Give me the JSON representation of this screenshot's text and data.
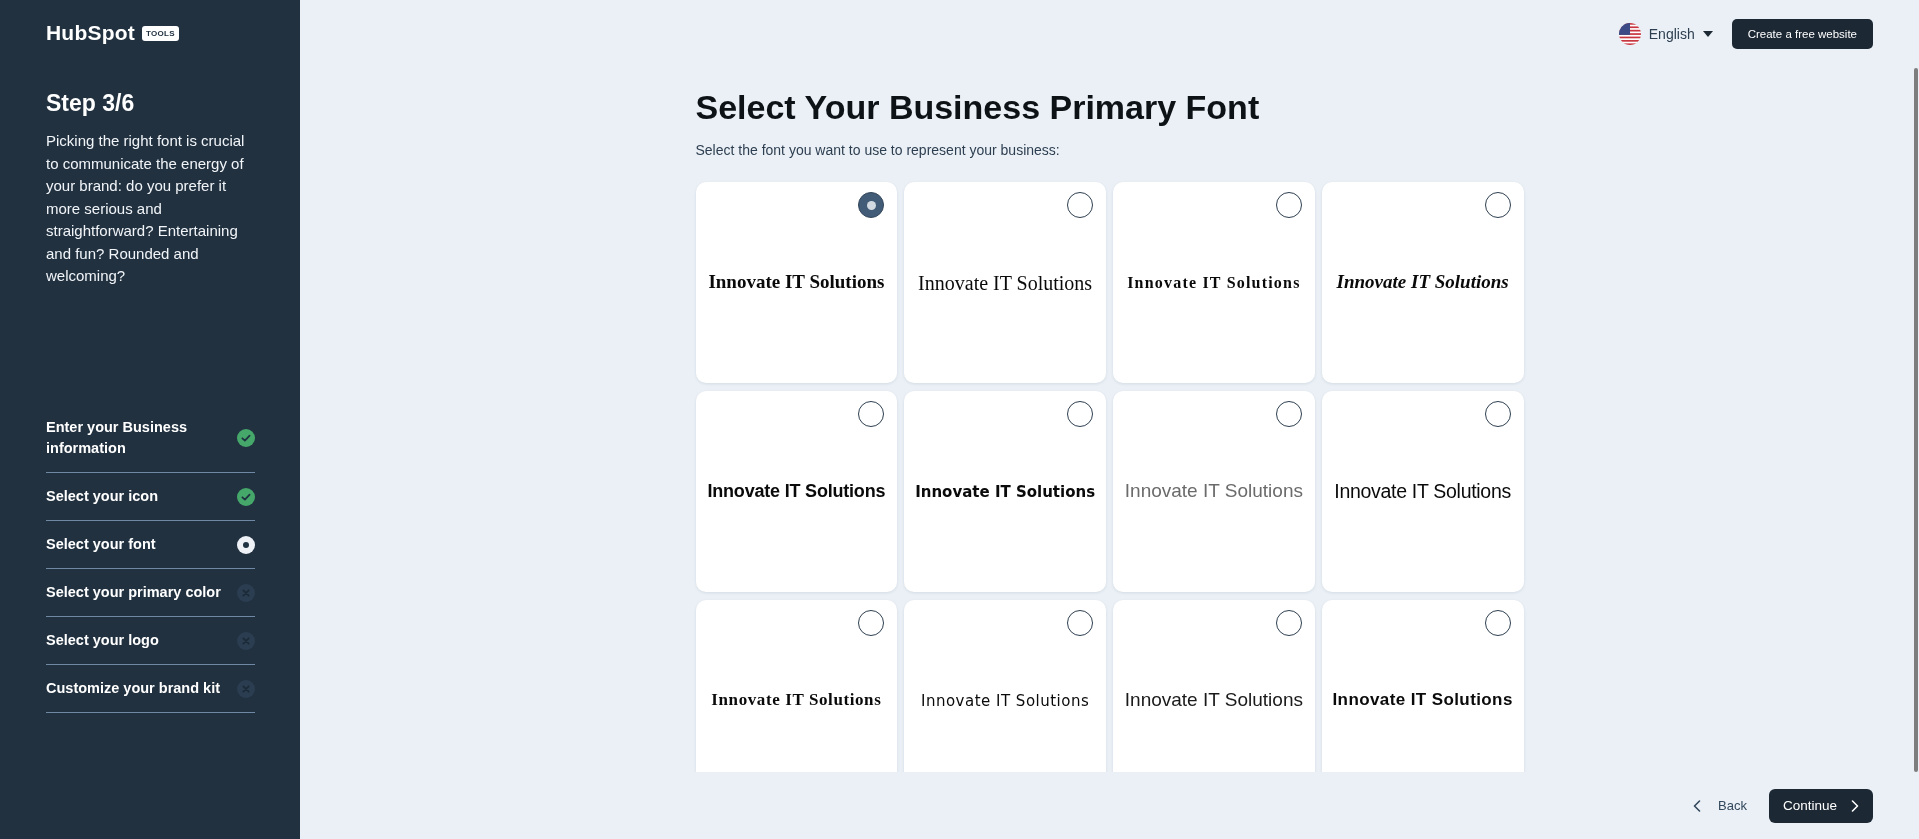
{
  "logo": {
    "name": "HubSpot",
    "badge": "TOOLS"
  },
  "sidebar": {
    "step": "Step 3/6",
    "description": "Picking the right font is crucial to communicate the energy of your brand: do you prefer it more serious and straightforward? Entertaining and fun? Rounded and welcoming?",
    "steps": [
      {
        "label": "Enter your Business information",
        "completed": true,
        "current": false
      },
      {
        "label": "Select your icon",
        "completed": true,
        "current": false
      },
      {
        "label": "Select your font",
        "completed": false,
        "current": true
      },
      {
        "label": "Select your primary color",
        "completed": false,
        "current": false
      },
      {
        "label": "Select your logo",
        "completed": false,
        "current": false
      },
      {
        "label": "Customize your brand kit",
        "completed": false,
        "current": false
      }
    ]
  },
  "header": {
    "language": "English",
    "cta": "Create a free website"
  },
  "title": "Select Your Business Primary Font",
  "subtitle": "Select the font you want to use to represent your business:",
  "font_options": [
    {
      "sample": "Innovate IT Solutions",
      "selected": true
    },
    {
      "sample": "Innovate IT Solutions",
      "selected": false
    },
    {
      "sample": "Innovate IT Solutions",
      "selected": false
    },
    {
      "sample": "Innovate IT Solutions",
      "selected": false
    },
    {
      "sample": "Innovate IT Solutions",
      "selected": false
    },
    {
      "sample": "Innovate IT Solutions",
      "selected": false
    },
    {
      "sample": "Innovate IT Solutions",
      "selected": false
    },
    {
      "sample": "Innovate IT Solutions",
      "selected": false
    },
    {
      "sample": "Innovate IT Solutions",
      "selected": false
    },
    {
      "sample": "Innovate IT Solutions",
      "selected": false
    },
    {
      "sample": "Innovate IT Solutions",
      "selected": false
    },
    {
      "sample": "Innovate IT Solutions",
      "selected": false
    }
  ],
  "footer": {
    "back": "Back",
    "continue": "Continue"
  }
}
